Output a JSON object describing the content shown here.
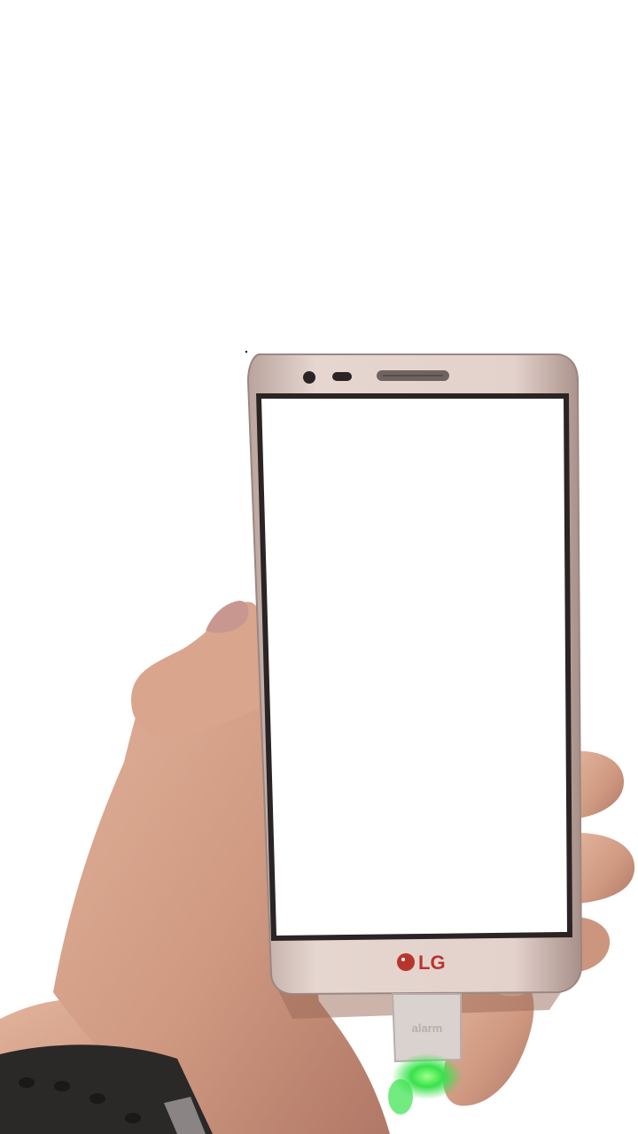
{
  "image": {
    "subject": "hand-holding-smartphone",
    "background_color": "#ffffff"
  },
  "phone": {
    "brand_text": "LG",
    "frame_color": "#d8c3bd",
    "screen_color": "#ffffff",
    "bezel_color": "#2a2424"
  },
  "security_tag": {
    "label": "alarm",
    "led_color": "#37e24a"
  },
  "colors": {
    "skin": "#d7a088",
    "skin_shadow": "#b97c64",
    "watch_band": "#2b2828"
  }
}
